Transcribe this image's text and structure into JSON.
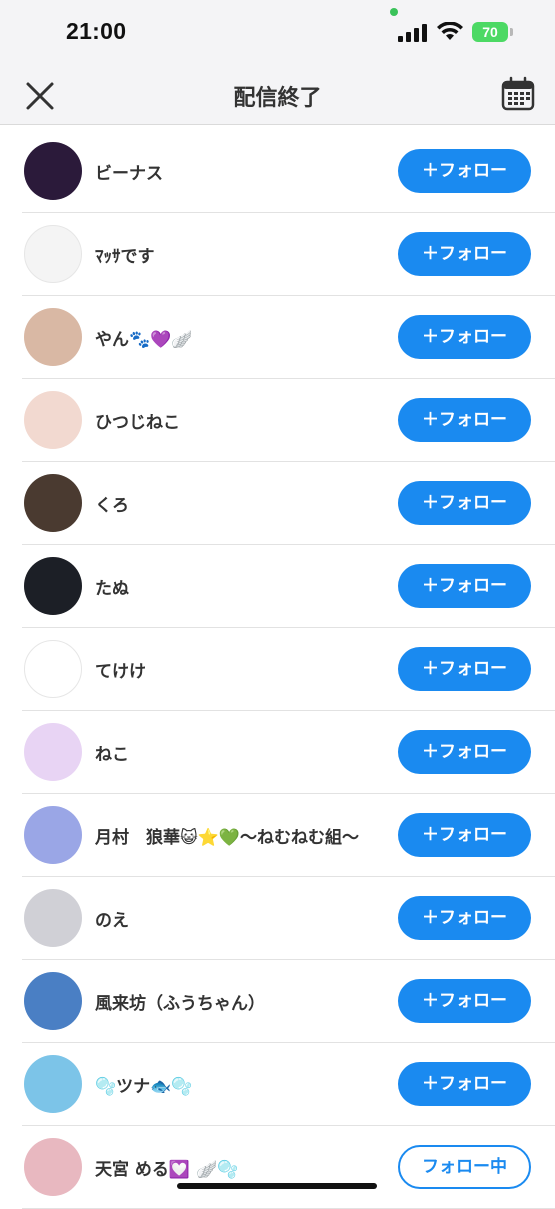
{
  "status": {
    "time": "21:00",
    "battery": "70"
  },
  "header": {
    "title": "配信終了"
  },
  "follow_label": "＋フォロー",
  "following_label": "フォロー中",
  "users": [
    {
      "name": "ビーナス",
      "avatar_color": "#2b1a3a",
      "following": false
    },
    {
      "name": "ﾏｯｻです",
      "avatar_color": "#f4f4f4",
      "following": false
    },
    {
      "name": "やん🐾💜🪽",
      "avatar_color": "#d9b8a4",
      "following": false
    },
    {
      "name": "ひつじねこ",
      "avatar_color": "#f2d9d0",
      "following": false
    },
    {
      "name": "くろ",
      "avatar_color": "#4a3a30",
      "following": false
    },
    {
      "name": "たぬ",
      "avatar_color": "#1c1f26",
      "following": false
    },
    {
      "name": "てけけ",
      "avatar_color": "#ffffff",
      "following": false
    },
    {
      "name": "ねこ",
      "avatar_color": "#e8d4f4",
      "following": false
    },
    {
      "name": "月村　狼華😺⭐💚〜ねむねむ組〜",
      "avatar_color": "#9aa6e6",
      "following": false
    },
    {
      "name": "のえ",
      "avatar_color": "#d0d0d6",
      "following": false
    },
    {
      "name": "風来坊（ふうちゃん）",
      "avatar_color": "#4a7fc4",
      "following": false
    },
    {
      "name": "🫧ツナ🐟🫧",
      "avatar_color": "#7cc4e8",
      "following": false
    },
    {
      "name": "天宮 める💟 🪽🫧",
      "avatar_color": "#e8b8c0",
      "following": true
    }
  ]
}
